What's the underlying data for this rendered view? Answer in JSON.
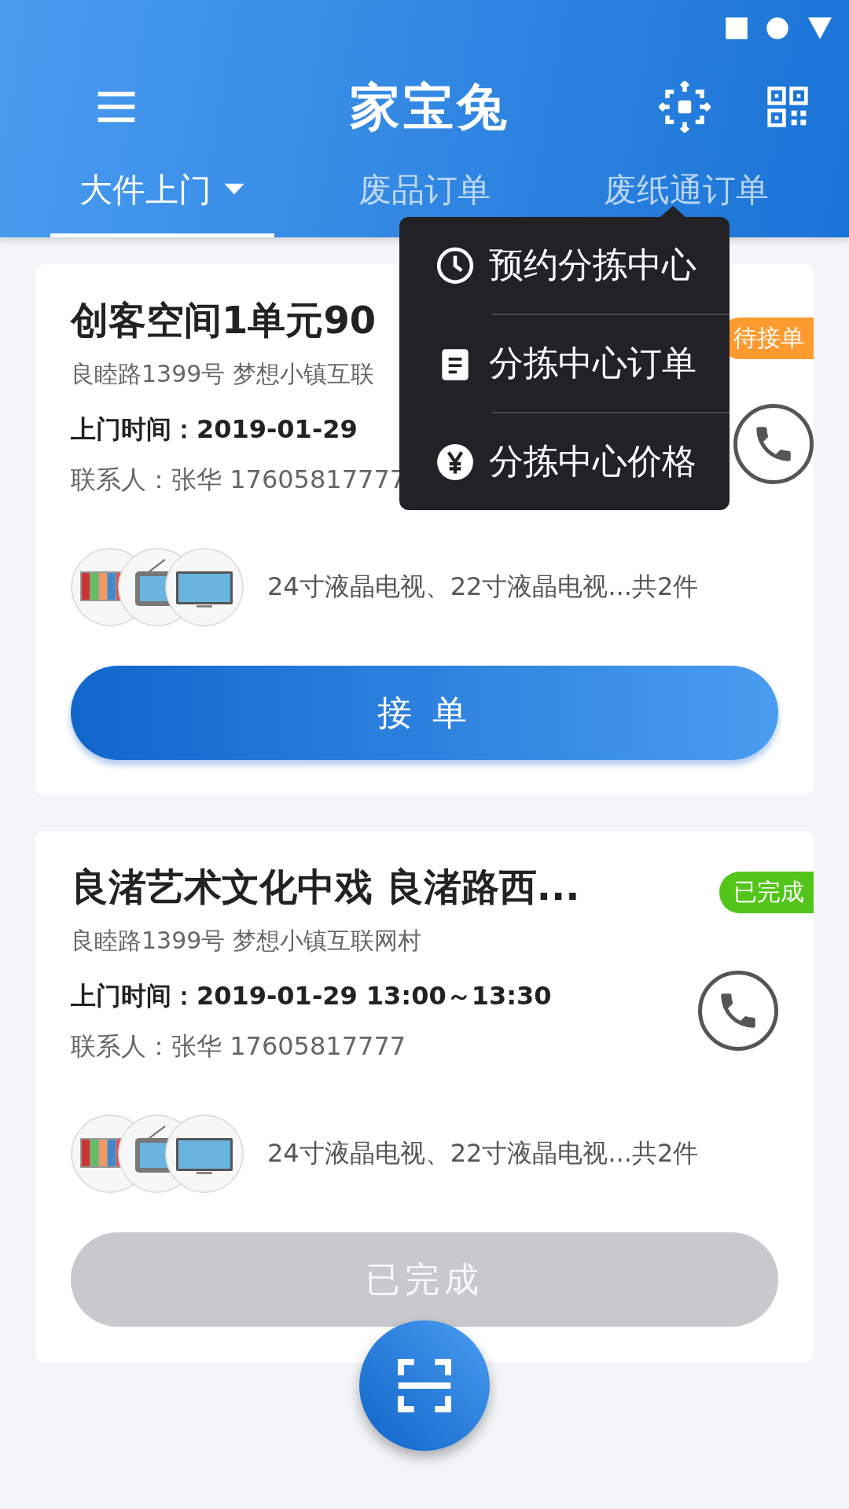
{
  "app_bar": {
    "title": "家宝兔"
  },
  "tabs": [
    {
      "label": "大件上门",
      "selected": true,
      "dropdown": true
    },
    {
      "label": "废品订单",
      "selected": false,
      "dropdown": false
    },
    {
      "label": "废纸通订单",
      "selected": false,
      "dropdown": false
    }
  ],
  "orders": [
    {
      "title": "创客空间1单元90",
      "status": "待接单",
      "color": "#ff9a2e",
      "address": "良睦路1399号 梦想小镇互联",
      "time_label": "上门时间：",
      "time": "2019-01-29",
      "contact": "联系人：张华 17605817777",
      "items_summary": "24寸液晶电视、22寸液晶电视...共2件",
      "action": {
        "label": "接 单",
        "disabled": false
      }
    },
    {
      "title": "良渚艺术文化中戏 良渚路西...",
      "status": "已完成",
      "color": "#52c41a",
      "address": "良睦路1399号 梦想小镇互联网村",
      "time_label": "上门时间：",
      "time": "2019-01-29 13:00～13:30",
      "contact": "联系人：张华 17605817777",
      "items_summary": "24寸液晶电视、22寸液晶电视...共2件",
      "action": {
        "label": "已完成",
        "disabled": true
      }
    }
  ],
  "popup_menu": [
    {
      "label": "预约分拣中心"
    },
    {
      "label": "分拣中心订单"
    },
    {
      "label": "分拣中心价格"
    }
  ]
}
